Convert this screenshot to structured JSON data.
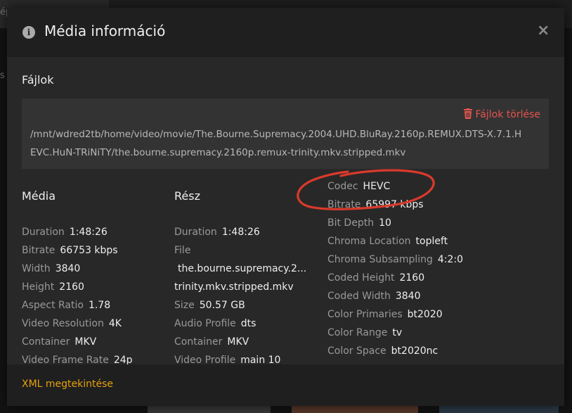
{
  "background": {
    "tab_fragment": "ép",
    "left_fragment": "s"
  },
  "modal": {
    "title": "Média információ",
    "files_heading": "Fájlok",
    "delete_label": "Fájlok törlése",
    "file_path": "/mnt/wdred2tb/home/video/movie/The.Bourne.Supremacy.2004.UHD.BluRay.2160p.REMUX.DTS-X.7.1.HEVC.HuN-TRiNiTY/the.bourne.supremacy.2160p.remux-trinity.mkv.stripped.mkv",
    "footer_link": "XML megtekintése"
  },
  "media": {
    "heading": "Média",
    "rows": [
      {
        "k": "Duration",
        "v": "1:48:26"
      },
      {
        "k": "Bitrate",
        "v": "66753 kbps"
      },
      {
        "k": "Width",
        "v": "3840"
      },
      {
        "k": "Height",
        "v": "2160"
      },
      {
        "k": "Aspect Ratio",
        "v": "1.78"
      },
      {
        "k": "Video Resolution",
        "v": "4K"
      },
      {
        "k": "Container",
        "v": "MKV"
      },
      {
        "k": "Video Frame Rate",
        "v": "24p"
      }
    ]
  },
  "part": {
    "heading": "Rész",
    "duration_k": "Duration",
    "duration_v": "1:48:26",
    "file_k": "File",
    "file_v1": "the.bourne.supremacy.2...",
    "file_v2": "trinity.mkv.stripped.mkv",
    "size_k": "Size",
    "size_v": "50.57 GB",
    "audio_k": "Audio Profile",
    "audio_v": "dts",
    "container_k": "Container",
    "container_v": "MKV",
    "video_k": "Video Profile",
    "video_v": "main 10"
  },
  "stream": {
    "rows": [
      {
        "k": "Codec",
        "v": "HEVC"
      },
      {
        "k": "Bitrate",
        "v": "65997 kbps"
      },
      {
        "k": "Bit Depth",
        "v": "10"
      },
      {
        "k": "Chroma Location",
        "v": "topleft"
      },
      {
        "k": "Chroma Subsampling",
        "v": "4:2:0"
      },
      {
        "k": "Coded Height",
        "v": "2160"
      },
      {
        "k": "Coded Width",
        "v": "3840"
      },
      {
        "k": "Color Primaries",
        "v": "bt2020"
      },
      {
        "k": "Color Range",
        "v": "tv"
      },
      {
        "k": "Color Space",
        "v": "bt2020nc"
      }
    ]
  },
  "colors": {
    "accent": "#e5a00d",
    "danger": "#e5544f",
    "annotation": "#d93a2b"
  },
  "icons": {
    "info": "info-icon",
    "close": "close-icon",
    "trash": "trash-icon"
  }
}
